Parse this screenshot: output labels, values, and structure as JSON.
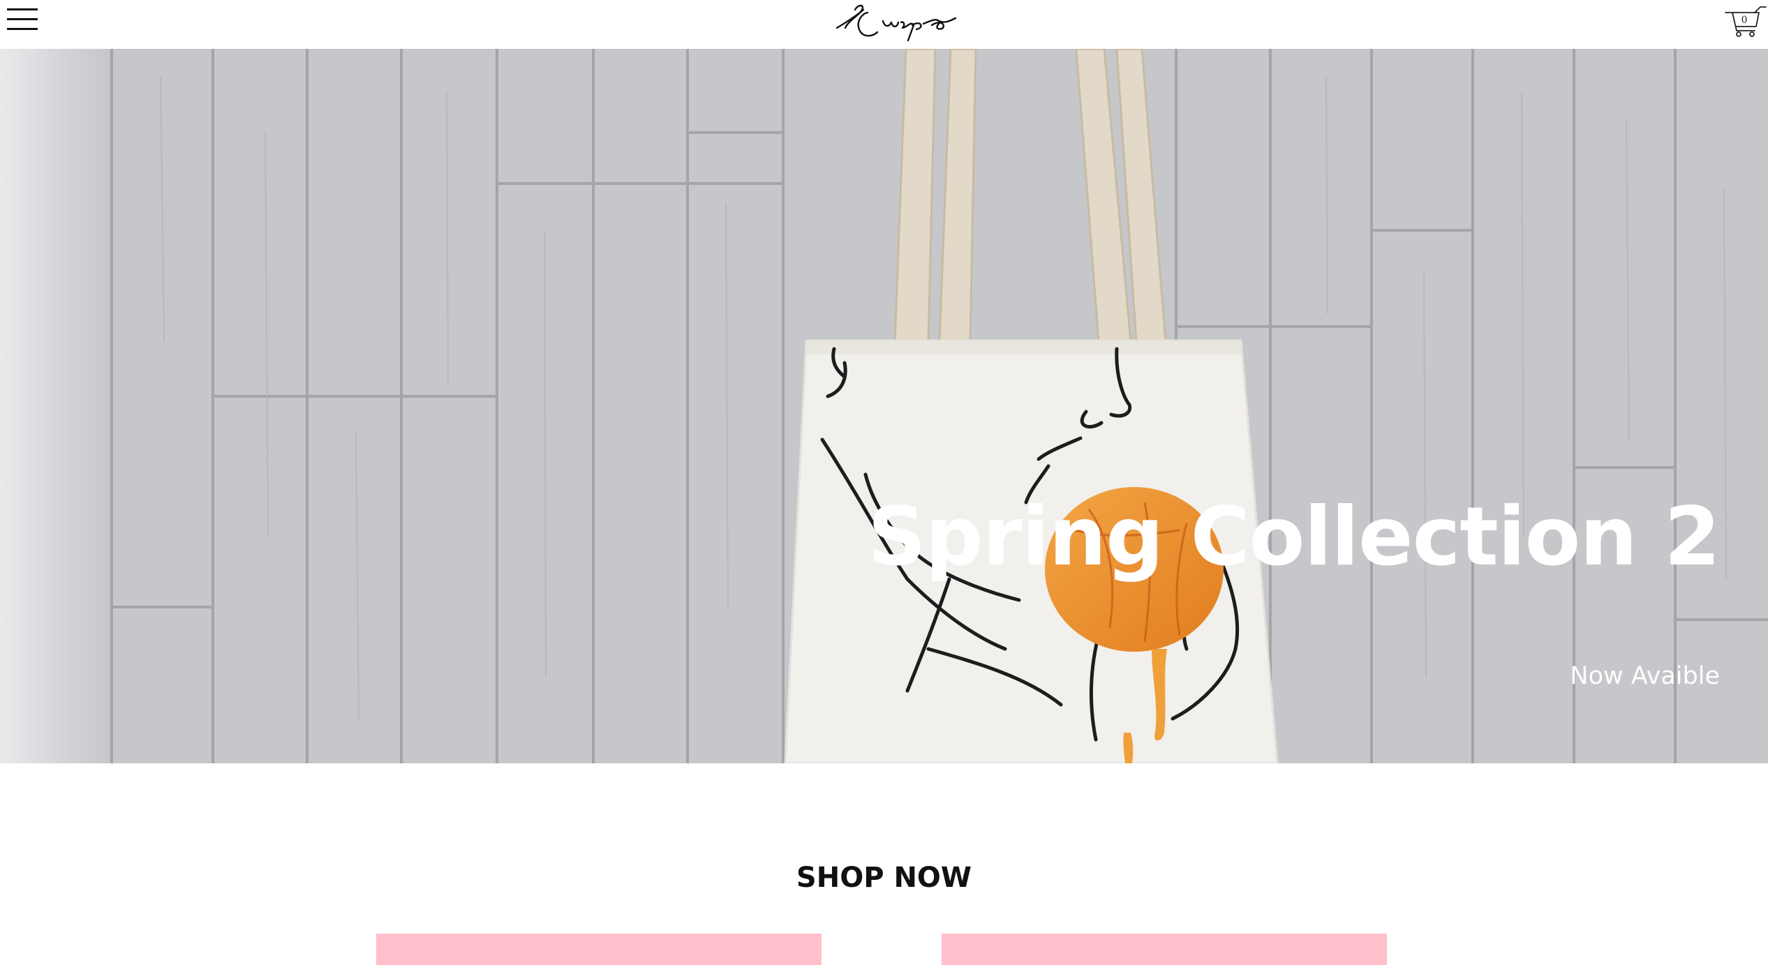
{
  "header": {
    "menu_icon": "hamburger-menu-icon",
    "logo_icon": "handwritten-signature-logo",
    "cart_icon": "shopping-cart-icon",
    "cart_count": "0"
  },
  "hero": {
    "title": "Spring Collection 2",
    "subtitle": "Now Avaible"
  },
  "shop": {
    "heading": "SHOP NOW",
    "card_color": "#ffc0cb"
  },
  "colors": {
    "hero_text": "#ffffff",
    "heading_text": "#111111",
    "accent_pink": "#ffc0cb"
  }
}
